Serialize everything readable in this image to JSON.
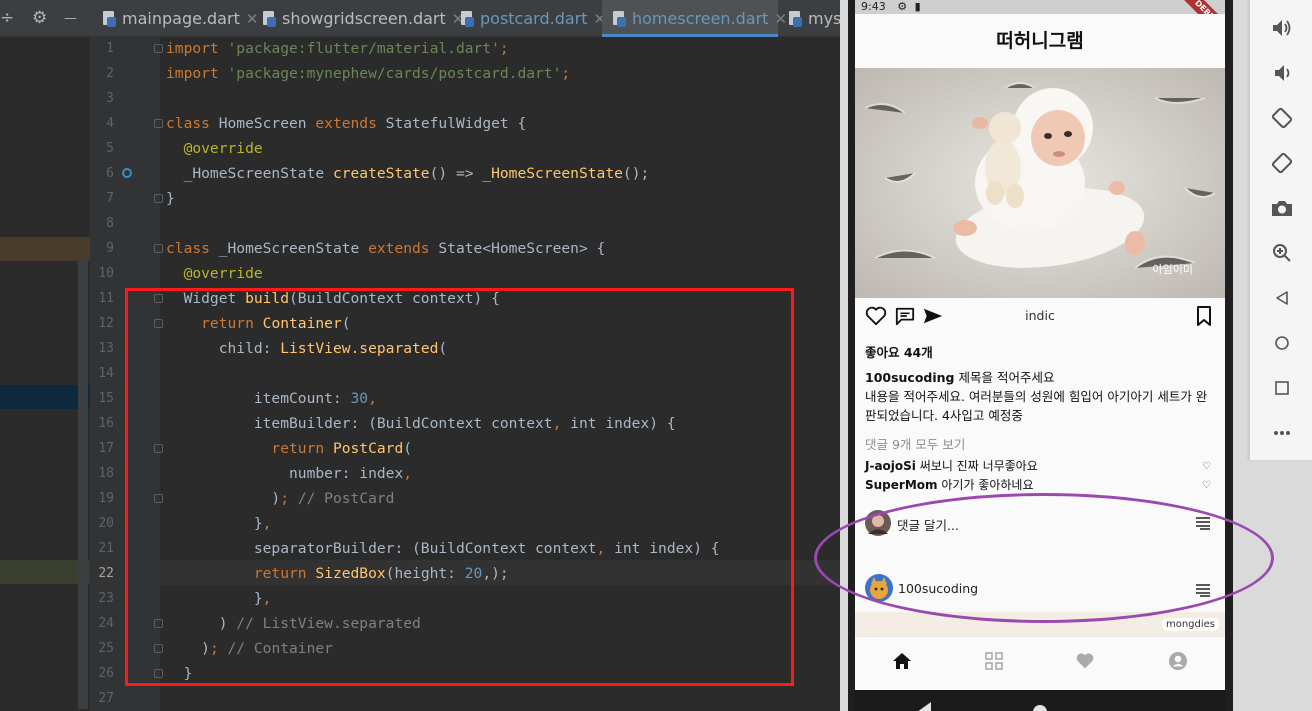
{
  "ide": {
    "tabs": [
      {
        "label": "mainpage.dart",
        "modified": false,
        "selected": false
      },
      {
        "label": "showgridscreen.dart",
        "modified": false,
        "selected": false
      },
      {
        "label": "postcard.dart",
        "modified": true,
        "selected": false
      },
      {
        "label": "homescreen.dart",
        "modified": true,
        "selected": true
      },
      {
        "label": "mys",
        "modified": false,
        "selected": false
      }
    ],
    "close_glyph": "✕",
    "toolbar_glyphs": {
      "left": "÷",
      "gear": "⚙",
      "minus": "—"
    },
    "line_numbers": [
      "1",
      "2",
      "3",
      "4",
      "5",
      "6",
      "7",
      "8",
      "9",
      "10",
      "11",
      "12",
      "13",
      "14",
      "15",
      "16",
      "17",
      "18",
      "19",
      "20",
      "21",
      "22",
      "23",
      "24",
      "25",
      "26",
      "27"
    ],
    "current_line": "22",
    "code": {
      "l1": [
        {
          "t": "import ",
          "c": "kw"
        },
        {
          "t": "'package:flutter/material.dart'",
          "c": "str"
        },
        {
          "t": ";",
          "c": "kw"
        }
      ],
      "l2": [
        {
          "t": "import ",
          "c": "kw"
        },
        {
          "t": "'package:mynephew/cards/postcard.dart'",
          "c": "str"
        },
        {
          "t": ";",
          "c": "kw"
        }
      ],
      "l4": [
        {
          "t": "class ",
          "c": "kw"
        },
        {
          "t": "HomeScreen ",
          "c": "pl"
        },
        {
          "t": "extends ",
          "c": "kw"
        },
        {
          "t": "StatefulWidget {",
          "c": "pl"
        }
      ],
      "l5": [
        {
          "t": "  @override",
          "c": "ann"
        }
      ],
      "l6": [
        {
          "t": "  _HomeScreenState ",
          "c": "pl"
        },
        {
          "t": "createState",
          "c": "fn"
        },
        {
          "t": "() => ",
          "c": "pl"
        },
        {
          "t": "_HomeScreenState",
          "c": "fn"
        },
        {
          "t": "();",
          "c": "pl"
        }
      ],
      "l7": [
        {
          "t": "}",
          "c": "pl"
        }
      ],
      "l9": [
        {
          "t": "class ",
          "c": "kw"
        },
        {
          "t": "_HomeScreenState ",
          "c": "pl"
        },
        {
          "t": "extends ",
          "c": "kw"
        },
        {
          "t": "State<HomeScreen> {",
          "c": "pl"
        }
      ],
      "l10": [
        {
          "t": "  @override",
          "c": "ann"
        }
      ],
      "l11": [
        {
          "t": "  Widget ",
          "c": "pl"
        },
        {
          "t": "build",
          "c": "fn"
        },
        {
          "t": "(BuildContext context) {",
          "c": "pl"
        }
      ],
      "l12": [
        {
          "t": "    return ",
          "c": "kw"
        },
        {
          "t": "Container",
          "c": "fn"
        },
        {
          "t": "(",
          "c": "pl"
        }
      ],
      "l13": [
        {
          "t": "      child: ",
          "c": "pl"
        },
        {
          "t": "ListView.separated",
          "c": "fn"
        },
        {
          "t": "(",
          "c": "pl"
        }
      ],
      "l15": [
        {
          "t": "          itemCount: ",
          "c": "pl"
        },
        {
          "t": "30",
          "c": "num"
        },
        {
          "t": ",",
          "c": "kw"
        }
      ],
      "l16": [
        {
          "t": "          itemBuilder: (BuildContext context",
          "c": "pl"
        },
        {
          "t": ", ",
          "c": "kw"
        },
        {
          "t": "int ",
          "c": "pl"
        },
        {
          "t": "index) {",
          "c": "pl"
        }
      ],
      "l17": [
        {
          "t": "            return ",
          "c": "kw"
        },
        {
          "t": "PostCard",
          "c": "fn"
        },
        {
          "t": "(",
          "c": "pl"
        }
      ],
      "l18": [
        {
          "t": "              number: index",
          "c": "pl"
        },
        {
          "t": ",",
          "c": "kw"
        }
      ],
      "l19": [
        {
          "t": "            )",
          "c": "pl"
        },
        {
          "t": "; ",
          "c": "kw"
        },
        {
          "t": "// PostCard",
          "c": "cm"
        }
      ],
      "l20": [
        {
          "t": "          }",
          "c": "pl"
        },
        {
          "t": ",",
          "c": "kw"
        }
      ],
      "l21": [
        {
          "t": "          separatorBuilder: (BuildContext context",
          "c": "pl"
        },
        {
          "t": ", ",
          "c": "kw"
        },
        {
          "t": "int ",
          "c": "pl"
        },
        {
          "t": "index) {",
          "c": "pl"
        }
      ],
      "l22": [
        {
          "t": "          return ",
          "c": "kw"
        },
        {
          "t": "SizedBox",
          "c": "fn"
        },
        {
          "t": "(height: ",
          "c": "pl"
        },
        {
          "t": "20",
          "c": "num"
        },
        {
          "t": ",);",
          "c": "pl"
        }
      ],
      "l23": [
        {
          "t": "          }",
          "c": "pl"
        },
        {
          "t": ",",
          "c": "kw"
        }
      ],
      "l24": [
        {
          "t": "      ) ",
          "c": "pl"
        },
        {
          "t": "// ListView.separated",
          "c": "cm"
        }
      ],
      "l25": [
        {
          "t": "    )",
          "c": "pl"
        },
        {
          "t": "; ",
          "c": "kw"
        },
        {
          "t": "// Container",
          "c": "cm"
        }
      ],
      "l26": [
        {
          "t": "  }",
          "c": "pl"
        }
      ]
    }
  },
  "phone": {
    "status_time": "9:43",
    "debug_banner": "DEBUG",
    "app_title": "떠허니그램",
    "photo_watermark": "아임이미",
    "author_center": "indic",
    "likes": "좋아요 44개",
    "caption_user": "100sucoding",
    "caption_title": "제목을 적어주세요",
    "caption_body": "내용을 적어주세요. 여러분들의 성원에 힘입어 아기아기 세트가 완판되었습니다. 4사입고 예정중",
    "view_all": "댓글 9개 모두 보기",
    "comments": [
      {
        "user": "J-aojoSi",
        "text": "써보니 진짜 너무좋아요"
      },
      {
        "user": "SuperMom",
        "text": "아기가 좋아하네요"
      }
    ],
    "add_comment": "댓글 달기...",
    "next_post_user": "100sucoding",
    "next_photo_tag": "mongdies",
    "colors": {
      "accent": "#262626",
      "debug": "#b13030"
    }
  },
  "emulator_tools": [
    "volume-up-icon",
    "volume-down-icon",
    "rotate-left-icon",
    "rotate-right-icon",
    "camera-icon",
    "zoom-icon",
    "back-icon",
    "home-icon",
    "overview-icon",
    "more-icon"
  ]
}
